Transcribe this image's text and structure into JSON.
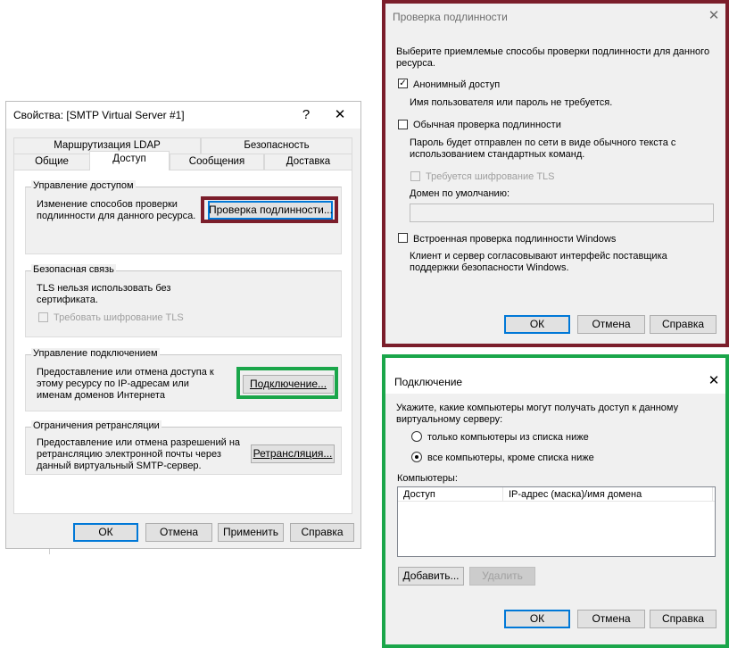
{
  "props_dialog": {
    "title": "Свойства: [SMTP Virtual Server #1]",
    "help_glyph": "?",
    "close_glyph": "✕",
    "tabs_back": [
      "Маршрутизация LDAP",
      "Безопасность"
    ],
    "tabs_front": [
      "Общие",
      "Доступ",
      "Сообщения",
      "Доставка"
    ],
    "access_group": {
      "label": "Управление доступом",
      "text": "Изменение способов проверки подлинности для данного ресурса.",
      "button": "Проверка подлинности..."
    },
    "secure_group": {
      "label": "Безопасная связь",
      "text": "TLS нельзя использовать без сертификата.",
      "checkbox": "Требовать шифрование TLS"
    },
    "connection_group": {
      "label": "Управление подключением",
      "text": "Предоставление или отмена доступа к этому ресурсу по IP-адресам или именам доменов Интернета",
      "button": "Подключение..."
    },
    "relay_group": {
      "label": "Ограничения ретрансляции",
      "text": "Предоставление или отмена разрешений на ретрансляцию электронной почты через данный виртуальный SMTP-сервер.",
      "button": "Ретрансляция..."
    },
    "buttons": {
      "ok": "ОК",
      "cancel": "Отмена",
      "apply": "Применить",
      "help": "Справка"
    }
  },
  "auth_dialog": {
    "title": "Проверка подлинности",
    "close_glyph": "✕",
    "intro": "Выберите приемлемые способы проверки подлинности для данного ресурса.",
    "anonymous": {
      "label": "Анонимный доступ",
      "checked": true,
      "desc": "Имя пользователя или пароль не требуется."
    },
    "basic": {
      "label": "Обычная проверка подлинности",
      "checked": false,
      "desc": "Пароль будет отправлен по сети в виде обычного текста с использованием стандартных команд."
    },
    "tls": {
      "label": "Требуется шифрование TLS",
      "checked": false
    },
    "domain_label": "Домен по умолчанию:",
    "domain_value": "",
    "windows": {
      "label": "Встроенная проверка подлинности Windows",
      "checked": false,
      "desc": "Клиент и сервер согласовывают интерфейс поставщика поддержки безопасности Windows."
    },
    "buttons": {
      "ok": "ОК",
      "cancel": "Отмена",
      "help": "Справка"
    }
  },
  "conn_dialog": {
    "title": "Подключение",
    "close_glyph": "✕",
    "intro": "Укажите, какие компьютеры могут получать доступ к данному виртуальному серверу:",
    "radio_only": "только компьютеры из списка ниже",
    "radio_except": "все компьютеры, кроме списка ниже",
    "selected": "except",
    "list_label": "Компьютеры:",
    "columns": [
      "Доступ",
      "IP-адрес (маска)/имя домена"
    ],
    "rows": [],
    "add_button": "Добавить...",
    "remove_button": "Удалить",
    "buttons": {
      "ok": "ОК",
      "cancel": "Отмена",
      "help": "Справка"
    }
  },
  "colors": {
    "highlight_red": "#7b1e2b",
    "highlight_green": "#1aa64a",
    "accent_blue": "#0078d7"
  }
}
